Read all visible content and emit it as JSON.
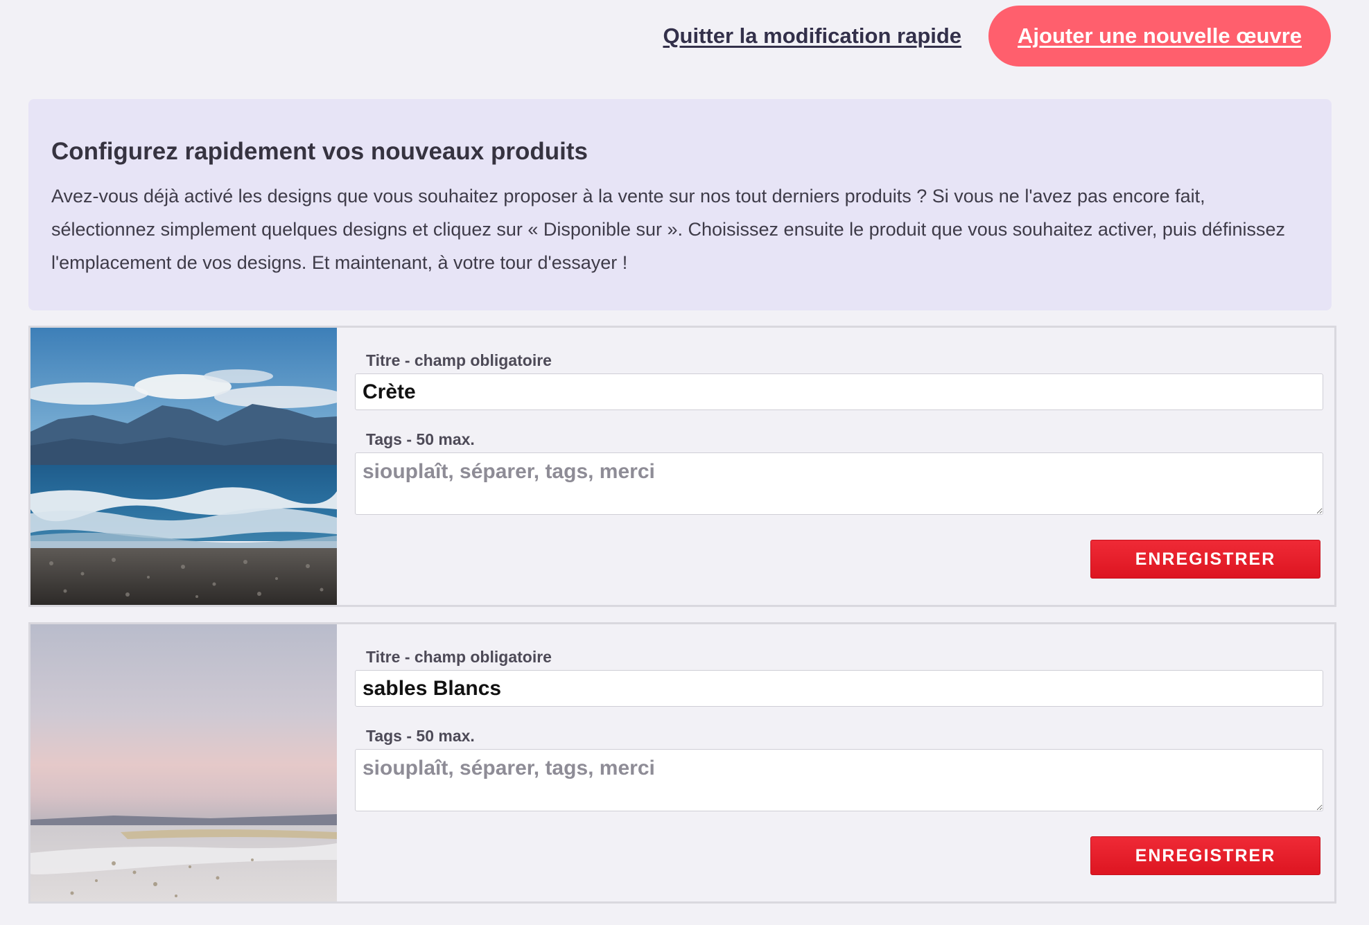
{
  "header": {
    "quit_label": "Quitter la modification rapide",
    "add_label": "Ajouter une nouvelle œuvre"
  },
  "info": {
    "title": "Configurez rapidement vos nouveaux produits",
    "text": "Avez-vous déjà activé les designs que vous souhaitez proposer à la vente sur nos tout derniers produits ? Si vous ne l'avez pas encore fait, sélectionnez simplement quelques designs et cliquez sur « Disponible sur ». Choisissez ensuite le produit que vous souhaitez activer, puis définissez l'emplacement de vos designs. Et maintenant, à votre tour d'essayer !"
  },
  "works": [
    {
      "title_label": "Titre - champ obligatoire",
      "title_value": "Crète",
      "tags_label": "Tags - 50 max.",
      "tags_placeholder": "siouplaît, séparer, tags, merci",
      "save_label": "ENREGISTRER"
    },
    {
      "title_label": "Titre - champ obligatoire",
      "title_value": "sables Blancs",
      "tags_label": "Tags - 50 max.",
      "tags_placeholder": "siouplaît, séparer, tags, merci",
      "save_label": "ENREGISTRER"
    }
  ],
  "colors": {
    "background": "#f2f1f6",
    "accent_pink": "#ff5f6d",
    "save_red": "#e61d29",
    "info_box": "#e7e4f6"
  }
}
